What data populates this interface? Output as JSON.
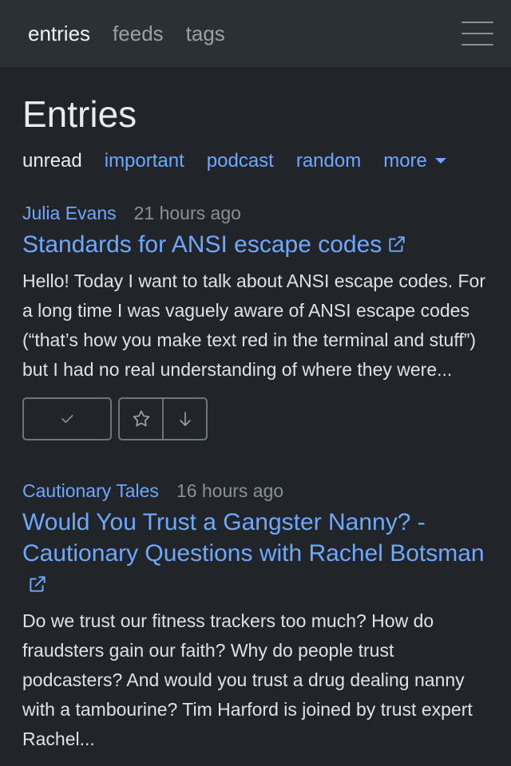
{
  "nav": {
    "links": [
      {
        "label": "entries",
        "active": true
      },
      {
        "label": "feeds",
        "active": false
      },
      {
        "label": "tags",
        "active": false
      }
    ],
    "menu_icon": "hamburger-icon"
  },
  "page": {
    "title": "Entries",
    "filters": [
      {
        "label": "unread",
        "active": true
      },
      {
        "label": "important",
        "active": false
      },
      {
        "label": "podcast",
        "active": false
      },
      {
        "label": "random",
        "active": false
      },
      {
        "label": "more",
        "active": false,
        "dropdown": true
      }
    ]
  },
  "entries": [
    {
      "source": "Julia Evans",
      "time": "21 hours ago",
      "title": "Standards for ANSI escape codes",
      "summary": "Hello! Today I want to talk about ANSI escape codes. For a long time I was vaguely aware of ANSI escape codes (“that’s how you make text red in the terminal and stuff”) but I had no real understanding of where they were..."
    },
    {
      "source": "Cautionary Tales",
      "time": "16 hours ago",
      "title": "Would You Trust a Gangster Nanny? - Cautionary Questions with Rachel Botsman",
      "summary": "Do we trust our fitness trackers too much? How do fraudsters gain our faith? Why do people trust podcasters? And would you trust a drug dealing nanny with a tambourine? Tim Harford is joined by trust expert Rachel..."
    }
  ],
  "colors": {
    "background": "#212529",
    "navbar": "#2b3035",
    "link": "#6ea8fe",
    "muted": "#8a9097",
    "text": "#dee2e6"
  },
  "icons": {
    "external": "external-link-icon",
    "mark_read": "check-icon",
    "star": "star-icon",
    "download": "arrow-down-icon"
  }
}
